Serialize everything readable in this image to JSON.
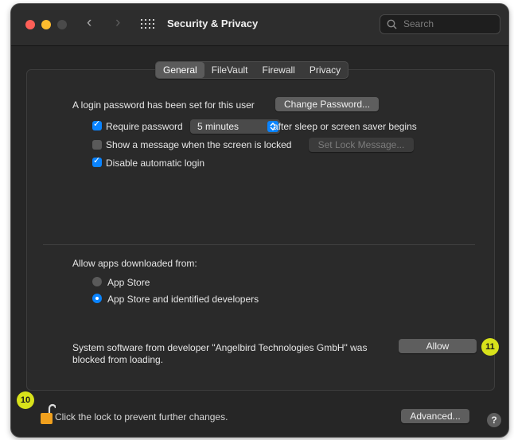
{
  "window": {
    "title": "Security & Privacy"
  },
  "search": {
    "placeholder": "Search"
  },
  "tabs": [
    {
      "label": "General",
      "active": true
    },
    {
      "label": "FileVault",
      "active": false
    },
    {
      "label": "Firewall",
      "active": false
    },
    {
      "label": "Privacy",
      "active": false
    }
  ],
  "general": {
    "login_password_text": "A login password has been set for this user",
    "change_password_label": "Change Password...",
    "require_password": {
      "label": "Require password",
      "checked": true,
      "value": "5 minutes",
      "suffix": "after sleep or screen saver begins"
    },
    "show_message": {
      "label": "Show a message when the screen is locked",
      "checked": false,
      "button_label": "Set Lock Message..."
    },
    "disable_autologin": {
      "label": "Disable automatic login",
      "checked": true
    }
  },
  "allow_apps": {
    "heading": "Allow apps downloaded from:",
    "options": [
      {
        "label": "App Store",
        "selected": false
      },
      {
        "label": "App Store and identified developers",
        "selected": true
      }
    ]
  },
  "blocked": {
    "line1": "System software from developer \"Angelbird Technologies GmbH\" was",
    "line2": "blocked from loading.",
    "allow_label": "Allow"
  },
  "footer": {
    "lock_text": "Click the lock to prevent further changes.",
    "advanced_label": "Advanced...",
    "help_label": "?"
  },
  "annotations": {
    "badge_lock": "10",
    "badge_allow": "11"
  },
  "colors": {
    "accent": "#0a84ff",
    "badge": "#d8e21b",
    "lock": "#f0a01e"
  }
}
